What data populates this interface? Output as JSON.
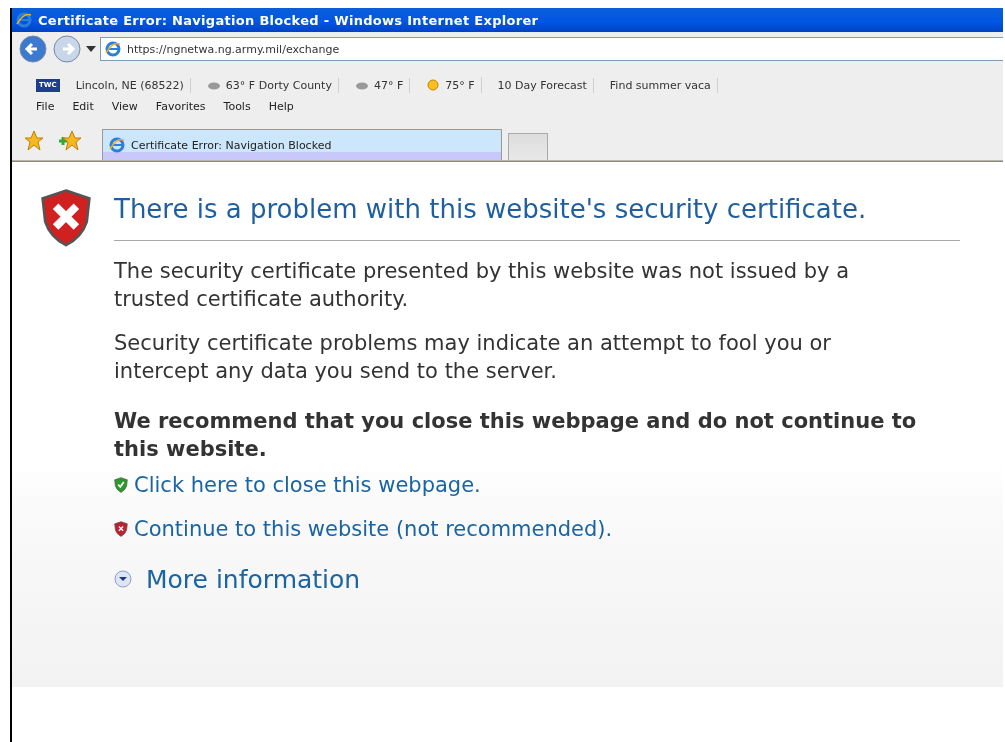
{
  "window": {
    "title": "Certificate Error: Navigation Blocked - Windows Internet Explorer"
  },
  "address_bar": {
    "url": "https://ngnetwa.ng.army.mil/exchange"
  },
  "links_bar": {
    "items": [
      {
        "kind": "logo",
        "label": "TWC"
      },
      {
        "kind": "text",
        "label": "Lincoln, NE (68522)"
      },
      {
        "kind": "weather",
        "label": "63° F Dorty County"
      },
      {
        "kind": "weather",
        "label": "47° F"
      },
      {
        "kind": "sun",
        "label": "75° F"
      },
      {
        "kind": "text",
        "label": "10 Day Forecast"
      },
      {
        "kind": "text",
        "label": "Find summer vaca"
      }
    ]
  },
  "menu": [
    "File",
    "Edit",
    "View",
    "Favorites",
    "Tools",
    "Help"
  ],
  "tabs": [
    {
      "label": "Certificate Error: Navigation Blocked",
      "selected": true
    }
  ],
  "page": {
    "heading": "There is a problem with this website's security certificate.",
    "paragraphs": [
      "The security certificate presented by this website was not issued by a trusted certificate authority.",
      "Security certificate problems may indicate an attempt to fool you or intercept any data you send to the server."
    ],
    "recommendation": "We recommend that you close this webpage and do not continue to this website.",
    "links": [
      {
        "kind": "safe",
        "label": "Click here to close this webpage."
      },
      {
        "kind": "unsafe",
        "label": "Continue to this website (not recommended)."
      }
    ],
    "more": {
      "label": "More information",
      "expanded": false
    }
  }
}
